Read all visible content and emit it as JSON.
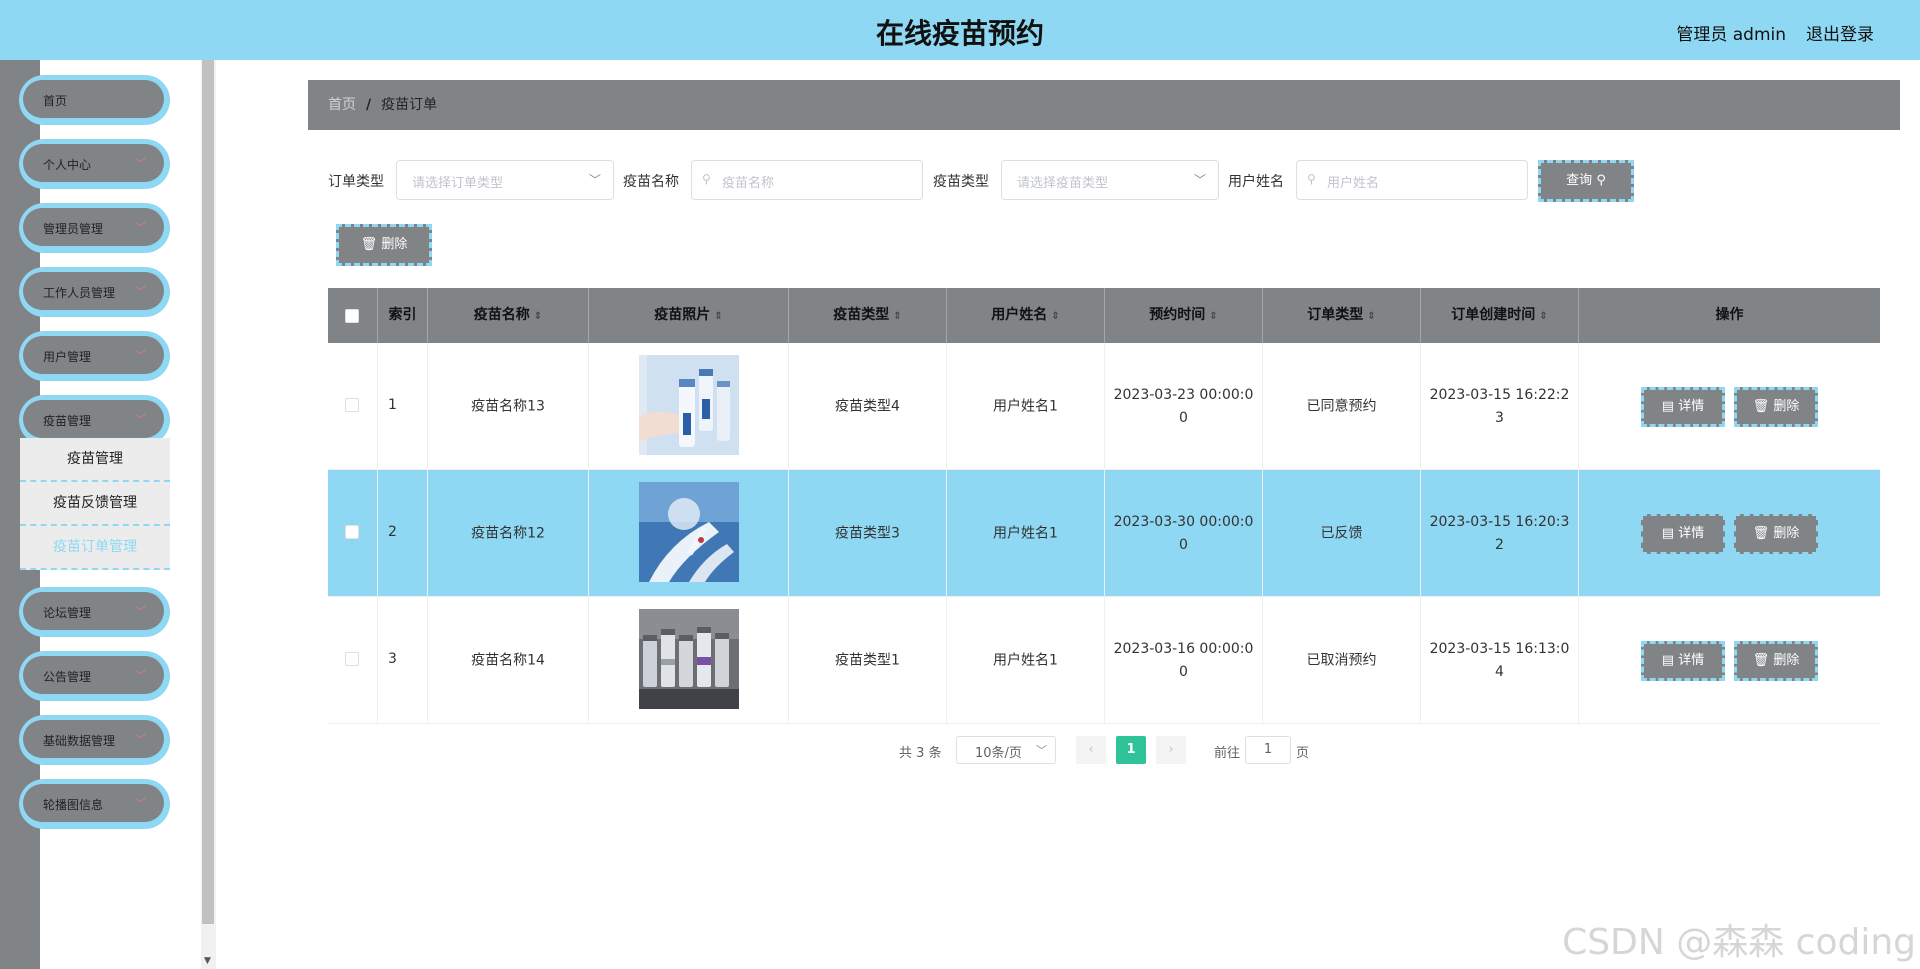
{
  "header": {
    "title": "在线疫苗预约",
    "user": "管理员 admin",
    "logout": "退出登录"
  },
  "sidebar": {
    "items": [
      {
        "label": "首页",
        "has_arrow": false
      },
      {
        "label": "个人中心",
        "has_arrow": true
      },
      {
        "label": "管理员管理",
        "has_arrow": true
      },
      {
        "label": "工作人员管理",
        "has_arrow": true
      },
      {
        "label": "用户管理",
        "has_arrow": true
      },
      {
        "label": "疫苗管理",
        "has_arrow": true
      },
      {
        "label": "论坛管理",
        "has_arrow": true
      },
      {
        "label": "公告管理",
        "has_arrow": true
      },
      {
        "label": "基础数据管理",
        "has_arrow": true
      },
      {
        "label": "轮播图信息",
        "has_arrow": true
      }
    ],
    "submenu": [
      "疫苗管理",
      "疫苗反馈管理",
      "疫苗订单管理"
    ],
    "submenu_active_index": 2
  },
  "breadcrumb": {
    "home": "首页",
    "separator": "/",
    "current": "疫苗订单"
  },
  "filters": {
    "order_type_label": "订单类型",
    "order_type_placeholder": "请选择订单类型",
    "vaccine_name_label": "疫苗名称",
    "vaccine_name_placeholder": "疫苗名称",
    "vaccine_type_label": "疫苗类型",
    "vaccine_type_placeholder": "请选择疫苗类型",
    "user_name_label": "用户姓名",
    "user_name_placeholder": "用户姓名",
    "query_button": "查询"
  },
  "toolbar": {
    "delete_button": "删除"
  },
  "table": {
    "columns": [
      "索引",
      "疫苗名称",
      "疫苗照片",
      "疫苗类型",
      "用户姓名",
      "预约时间",
      "订单类型",
      "订单创建时间",
      "操作"
    ],
    "rows": [
      {
        "index": "1",
        "vaccine_name": "疫苗名称13",
        "vaccine_type": "疫苗类型4",
        "user_name": "用户姓名1",
        "appointment_time": "2023-03-23 00:00:00",
        "order_type": "已同意预约",
        "created_time": "2023-03-15 16:22:23",
        "highlighted": false
      },
      {
        "index": "2",
        "vaccine_name": "疫苗名称12",
        "vaccine_type": "疫苗类型3",
        "user_name": "用户姓名1",
        "appointment_time": "2023-03-30 00:00:00",
        "order_type": "已反馈",
        "created_time": "2023-03-15 16:20:32",
        "highlighted": true
      },
      {
        "index": "3",
        "vaccine_name": "疫苗名称14",
        "vaccine_type": "疫苗类型1",
        "user_name": "用户姓名1",
        "appointment_time": "2023-03-16 00:00:00",
        "order_type": "已取消预约",
        "created_time": "2023-03-15 16:13:04",
        "highlighted": false
      }
    ],
    "detail_button": "详情",
    "delete_button": "删除"
  },
  "pagination": {
    "total": "共 3 条",
    "page_size": "10条/页",
    "current_page": "1",
    "goto_label": "前往",
    "goto_value": "1",
    "page_suffix": "页"
  },
  "watermark": "CSDN @森森 coding",
  "colors": {
    "header_bg": "#8fd8f3",
    "gray": "#808486",
    "accent": "#2fc39a"
  }
}
